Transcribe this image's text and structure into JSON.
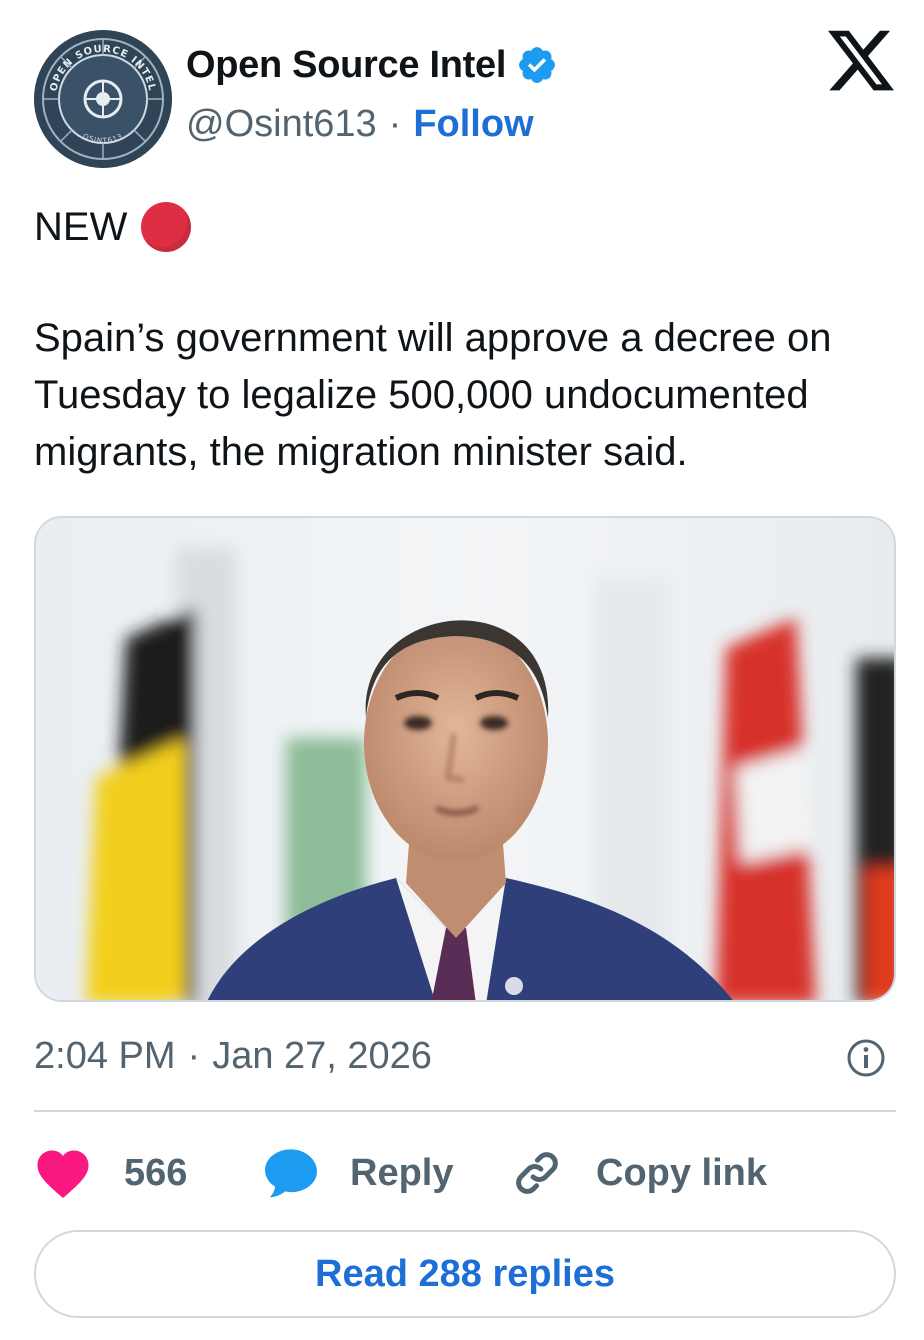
{
  "author": {
    "name": "Open Source Intel",
    "handle": "@Osint613",
    "separator": "·",
    "follow_label": "Follow",
    "verified_icon": "verified-badge-icon",
    "avatar_text_top": "OPEN SOURCE INTEL",
    "avatar_text_bottom": "OSINT613"
  },
  "platform_logo": "x-logo-icon",
  "tweet": {
    "tag": "NEW",
    "tag_icon": "red-circle-emoji",
    "text": "Spain’s government will approve a decree on Tuesday to legalize 500,000 undocumented migrants, the migration minister said.",
    "time": "2:04 PM",
    "separator": "·",
    "date": "Jan 27, 2026"
  },
  "actions": {
    "likes_count": "566",
    "reply_label": "Reply",
    "copy_link_label": "Copy link",
    "read_replies_label": "Read 288 replies"
  },
  "colors": {
    "like_heart": "#f91880",
    "reply_bubble": "#1d9bf0",
    "link_blue": "#1d6fd6",
    "verified": "#1d9bf0",
    "red_dot": "#dd2e44",
    "muted_text": "#536471"
  }
}
